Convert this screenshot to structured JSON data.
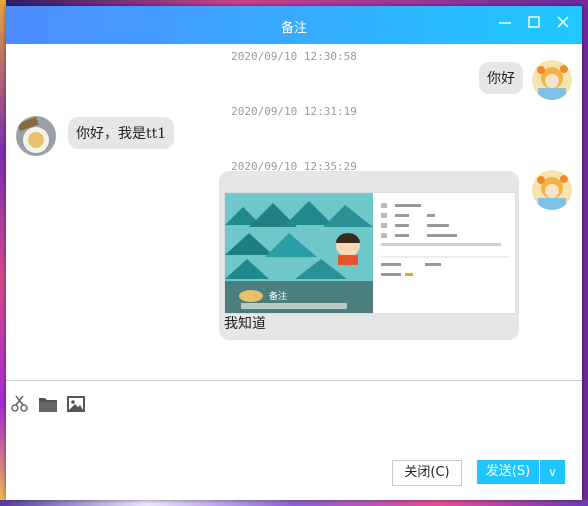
{
  "window": {
    "title": "备注"
  },
  "messages": [
    {
      "time": "2020/09/10 12:30:58",
      "text": "你好"
    },
    {
      "time": "2020/09/10 12:31:19",
      "text": "你好，我是tt1"
    },
    {
      "time": "2020/09/10 12:35:29",
      "text": "我知道"
    }
  ],
  "toolbar": {
    "icons": [
      "scissors-icon",
      "folder-icon",
      "image-icon"
    ]
  },
  "buttons": {
    "close": "关闭(C)",
    "send": "发送(S)",
    "send_dropdown": "∨"
  },
  "input": {
    "value": ""
  },
  "colors": {
    "title_gradient_start": "#4f8cff",
    "title_gradient_end": "#1ec9ff",
    "send": "#1ec6ff",
    "bubble": "#e6e6e6"
  }
}
